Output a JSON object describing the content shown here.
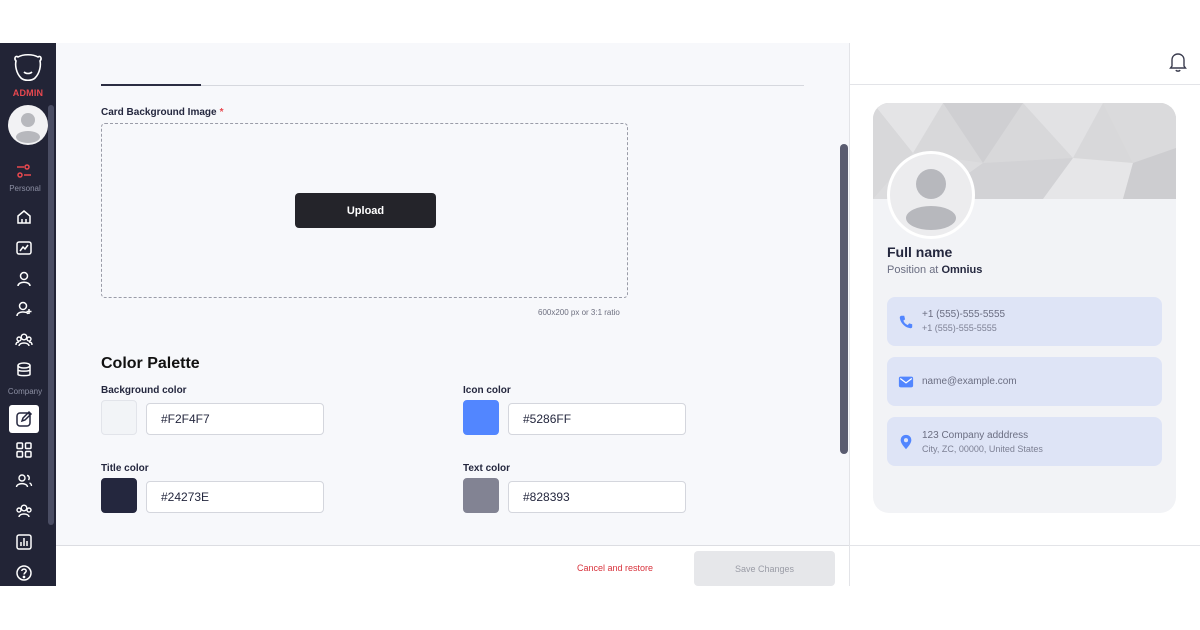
{
  "sidebar": {
    "role_label": "ADMIN",
    "section_personal": "Personal",
    "section_company": "Company",
    "accent_color": "#E8484F",
    "icons": [
      "logo-icon",
      "avatar",
      "sliders-icon",
      "home-icon",
      "chart-icon",
      "user-icon",
      "user-add-icon",
      "users-icon",
      "database-icon",
      "edit-icon",
      "grid-icon",
      "user-group-icon",
      "team-icon",
      "bar-chart-icon",
      "help-icon"
    ]
  },
  "form": {
    "card_bg_label": "Card Background Image",
    "required_mark": "*",
    "upload_label": "Upload",
    "upload_hint": "600x200 px or 3:1 ratio",
    "palette_title": "Color Palette",
    "colors": {
      "background": {
        "label": "Background color",
        "value": "#F2F4F7"
      },
      "icon": {
        "label": "Icon color",
        "value": "#5286FF"
      },
      "title": {
        "label": "Title color",
        "value": "#24273E"
      },
      "text": {
        "label": "Text color",
        "value": "#828393"
      }
    }
  },
  "footer": {
    "cancel_label": "Cancel and restore",
    "save_label": "Save Changes"
  },
  "preview": {
    "full_name": "Full name",
    "position_prefix": "Position at",
    "company": "Omnius",
    "phone_1": "+1 (555)-555-5555",
    "phone_2": "+1 (555)-555-5555",
    "email": "name@example.com",
    "address_1": "123 Company adddress",
    "address_2": "City, ZC, 00000, United States"
  }
}
